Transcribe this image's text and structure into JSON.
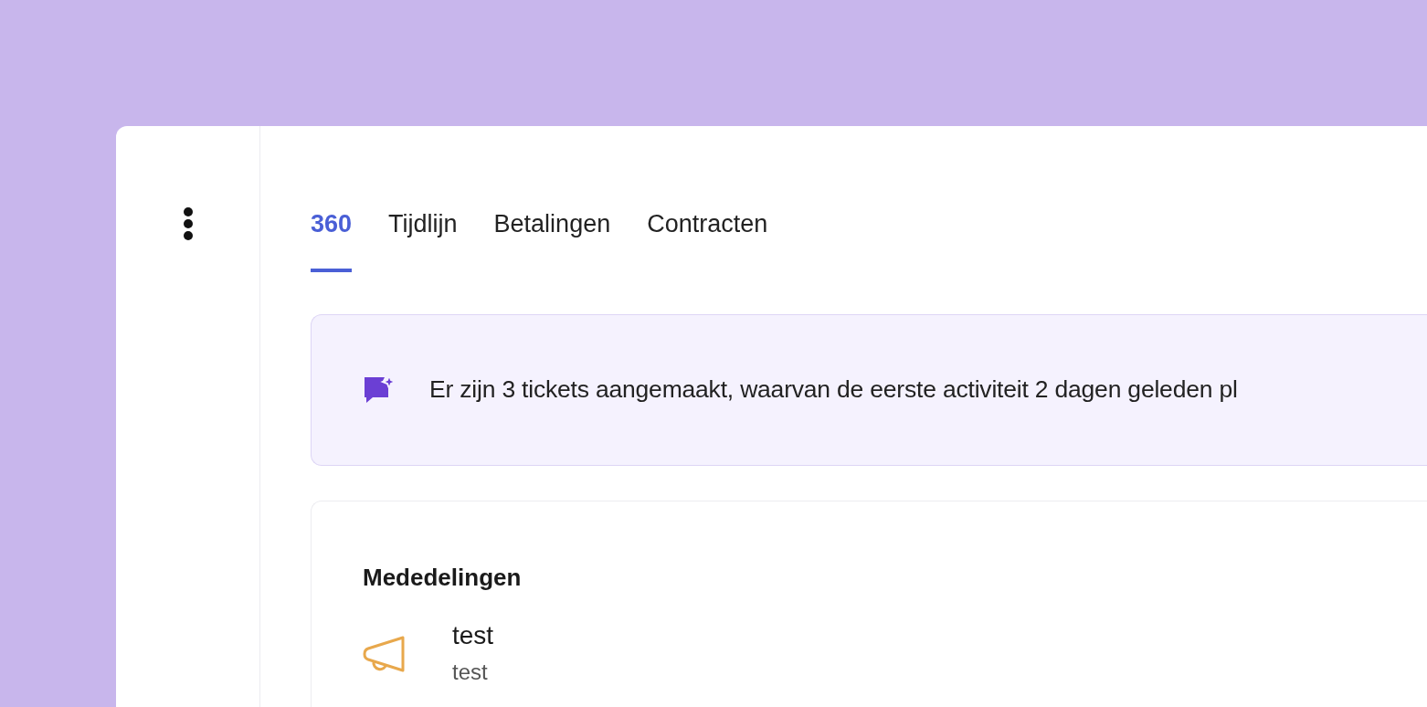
{
  "tabs": [
    {
      "label": "360",
      "selected": true
    },
    {
      "label": "Tijdlijn",
      "selected": false
    },
    {
      "label": "Betalingen",
      "selected": false
    },
    {
      "label": "Contracten",
      "selected": false
    }
  ],
  "insight": {
    "text": "Er zijn 3 tickets aangemaakt, waarvan de eerste activiteit 2 dagen geleden pl"
  },
  "announcements": {
    "title": "Mededelingen",
    "items": [
      {
        "title": "test",
        "body": "test"
      }
    ]
  }
}
